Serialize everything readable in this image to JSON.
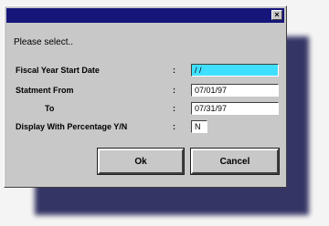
{
  "dialog": {
    "close_glyph": "×",
    "prompt": "Please select..",
    "fields": [
      {
        "label": "Fiscal Year Start Date",
        "colon": ":",
        "value": " / /"
      },
      {
        "label": "Statment From",
        "colon": ":",
        "value": "07/01/97"
      },
      {
        "label": "To",
        "colon": ":",
        "value": "07/31/97"
      },
      {
        "label": "Display With Percentage Y/N",
        "colon": ":",
        "value": "N"
      }
    ],
    "ok_label": "Ok",
    "cancel_label": "Cancel"
  }
}
